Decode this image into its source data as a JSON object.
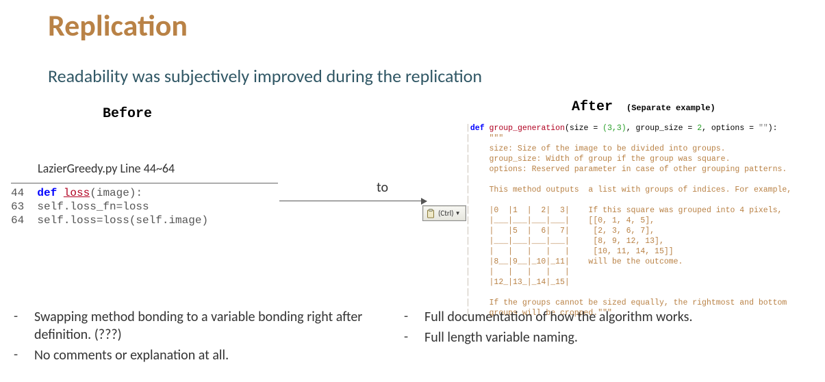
{
  "title": "Replication",
  "subtitle": "Readability was subjectively improved during the replication",
  "before": {
    "heading": "Before",
    "file_label": "LazierGreedy.py Line 44~64",
    "line1_no": "44",
    "line1_kw": "def",
    "line1_fn": "loss",
    "line1_rest": "(image):",
    "line2_no": "63",
    "line2_text": "self.loss_fn=loss",
    "line3_no": "64",
    "line3_text": "self.loss=loss(self.image)"
  },
  "connector": {
    "to_label": "to",
    "paste_label": "(Ctrl)"
  },
  "after": {
    "heading": "After",
    "separate": "(Separate example)",
    "def_kw": "def",
    "def_fn": "group_generation",
    "def_sig_open": "(size = ",
    "def_sig_size": "(3,3)",
    "def_sig_mid1": ", group_size = ",
    "def_sig_gs": "2",
    "def_sig_mid2": ", options = ",
    "def_sig_opts": "\"\"",
    "def_sig_close": "):",
    "doc1": "    \"\"\"",
    "doc2": "    size: Size of the image to be divided into groups.",
    "doc3": "    group_size: Width of group if the group was square.",
    "doc4": "    options: Reserved parameter in case of other grouping patterns.",
    "doc5": "",
    "doc6": "    This method outputs  a list with groups of indices. For example,",
    "doc7": "",
    "grid1": "    |0  |1  |  2|  3|    If this square was grouped into 4 pixels,",
    "grid2": "    |___|___|___|___|    [[0, 1, 4, 5],",
    "grid3": "    |   |5  |  6|  7|     [2, 3, 6, 7],",
    "grid4": "    |___|___|___|___|     [8, 9, 12, 13],",
    "grid5": "    |   |   |   |   |     [10, 11, 14, 15]]",
    "grid6": "    |8__|9__|_10|_11|    will be the outcome.",
    "grid7": "    |   |   |   |   |",
    "grid8": "    |12_|13_|_14|_15|",
    "doc8": "",
    "doc9": "    If the groups cannot be sized equally, the rightmost and bottom",
    "doc10": "    groups will be cropped.\"\"\""
  },
  "bullets_left": [
    "Swapping method bonding to a variable bonding right after definition. (???)",
    "No comments or explanation at all."
  ],
  "bullets_right": [
    "Full documentation of how the algorithm works.",
    "Full length variable naming."
  ]
}
